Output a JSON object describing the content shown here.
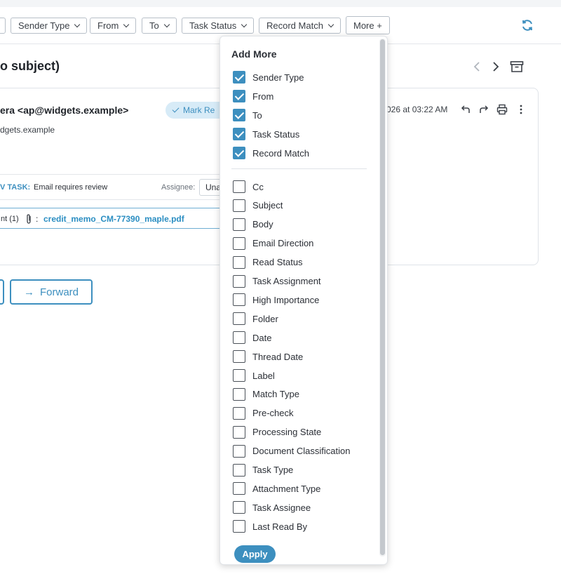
{
  "filters": {
    "chips": [
      {
        "label": "Sender Type"
      },
      {
        "label": "From"
      },
      {
        "label": "To"
      },
      {
        "label": "Task Status"
      },
      {
        "label": "Record Match"
      }
    ],
    "more_label": "More +",
    "refresh_icon": "refresh-icon"
  },
  "email": {
    "subject": "o subject)",
    "sender": "era <ap@widgets.example>",
    "sender_address": "dgets.example",
    "mark_label": "Mark Re",
    "date": "026 at 03:22 AM",
    "task_label": "V TASK:",
    "task_text": "Email requires review",
    "assignee_label": "Assignee:",
    "assignee_value": "Una",
    "attachment_count": "nt (1)",
    "attachment_separator": ":",
    "attachment_file": "credit_memo_CM-77390_maple.pdf",
    "forward_label": "Forward"
  },
  "add_more": {
    "title": "Add More",
    "checked": [
      "Sender Type",
      "From",
      "To",
      "Task Status",
      "Record Match"
    ],
    "unchecked": [
      "Cc",
      "Subject",
      "Body",
      "Email Direction",
      "Read Status",
      "Task Assignment",
      "High Importance",
      "Folder",
      "Date",
      "Thread Date",
      "Label",
      "Match Type",
      "Pre-check",
      "Processing State",
      "Document Classification",
      "Task Type",
      "Attachment Type",
      "Task Assignee",
      "Last Read By"
    ],
    "apply_label": "Apply"
  },
  "colors": {
    "accent": "#3d8fbf",
    "mark_bg": "#d7ebf7"
  }
}
